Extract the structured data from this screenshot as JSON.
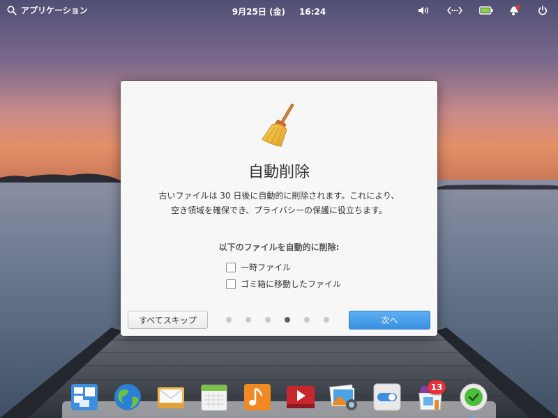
{
  "panel": {
    "applications_label": "アプリケーション",
    "date": "9月25日 (金)",
    "time": "16:24",
    "indicators": [
      "sound-icon",
      "network-icon",
      "battery-icon",
      "notifications-icon",
      "power-icon"
    ]
  },
  "dialog": {
    "icon": "broom-icon",
    "title": "自動削除",
    "description_line1": "古いファイルは 30 日後に自動的に削除されます。これにより、",
    "description_line2": "空き領域を確保でき、プライバシーの保護に役立ちます。",
    "options_title": "以下のファイルを自動的に削除:",
    "options": [
      {
        "label": "一時ファイル",
        "checked": false
      },
      {
        "label": "ゴミ箱に移動したファイル",
        "checked": false
      }
    ],
    "skip_label": "すべてスキップ",
    "next_label": "次へ",
    "pages": {
      "total": 6,
      "current": 4
    }
  },
  "dock": {
    "apps": [
      "multitasking-view-icon",
      "web-browser-icon",
      "mail-icon",
      "calendar-icon",
      "music-icon",
      "videos-icon",
      "photos-icon",
      "system-settings-icon",
      "appcenter-icon",
      "onboarding-icon"
    ],
    "badge_count": "13"
  },
  "colors": {
    "accent": "#3a8fe0",
    "badge": "#e8323a",
    "active_dot": "#5e5e5e"
  }
}
